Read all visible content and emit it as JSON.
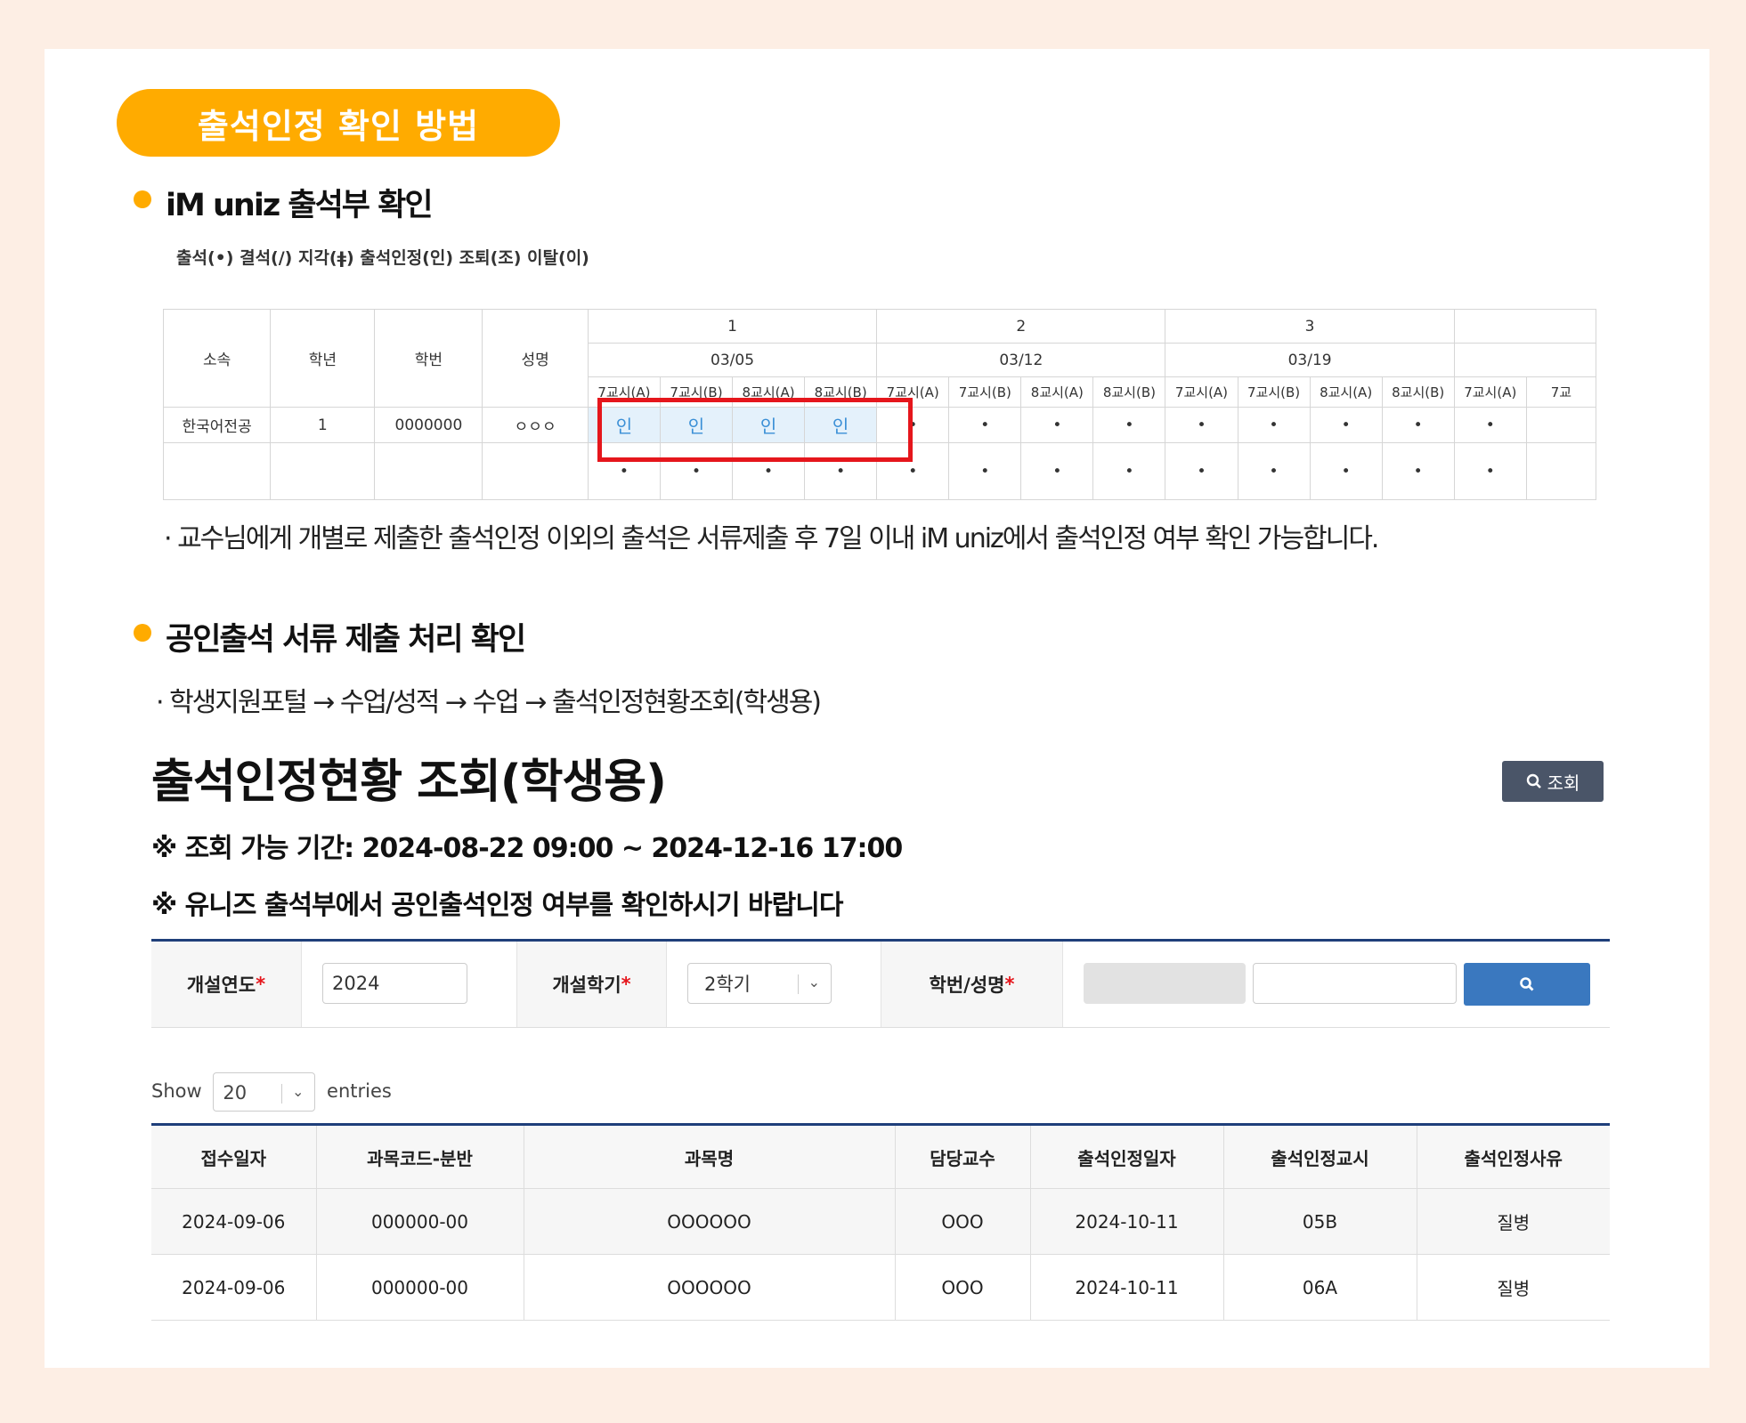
{
  "section_pill": "출석인정 확인 방법",
  "section1": {
    "heading": "iM uniz 출석부 확인",
    "legend": "출석(•) 결석(/) 지각(ǂ) 출석인정(인) 조퇴(조) 이탈(이)",
    "grid": {
      "headers": {
        "affiliation": "소속",
        "grade": "학년",
        "student_no": "학번",
        "name": "성명"
      },
      "weeks": [
        "1",
        "2",
        "3"
      ],
      "dates": [
        "03/05",
        "03/12",
        "03/19"
      ],
      "periods": [
        "7교시(A)",
        "7교시(B)",
        "8교시(A)",
        "8교시(B)",
        "7교시(A)",
        "7교시(B)",
        "8교시(A)",
        "8교시(B)",
        "7교시(A)",
        "7교시(B)",
        "8교시(A)",
        "8교시(B)",
        "7교시(A)",
        "7교"
      ],
      "row1": {
        "affiliation": "한국어전공",
        "grade": "1",
        "student_no": "0000000",
        "name": "ㅇㅇㅇ",
        "marks": [
          "인",
          "인",
          "인",
          "인",
          "•",
          "•",
          "•",
          "•",
          "•",
          "•",
          "•",
          "•",
          "•",
          ""
        ]
      },
      "row2": {
        "marks": [
          "•",
          "•",
          "•",
          "•",
          "•",
          "•",
          "•",
          "•",
          "•",
          "•",
          "•",
          "•",
          "•",
          ""
        ]
      }
    },
    "note": "· 교수님에게 개별로 제출한 출석인정 이외의 출석은 서류제출 후 7일 이내 iM uniz에서 출석인정 여부 확인 가능합니다."
  },
  "section2": {
    "heading": "공인출석 서류 제출 처리 확인",
    "path": "· 학생지원포털 → 수업/성적 → 수업 → 출석인정현황조회(학생용)"
  },
  "portal": {
    "title": "출석인정현황 조회(학생용)",
    "search_button": "조회",
    "period_note": "※ 조회 가능 기간: 2024-08-22 09:00 ~ 2024-12-16 17:00",
    "check_note": "※ 유니즈 출석부에서 공인출석인정 여부를 확인하시기 바랍니다",
    "filter": {
      "year_label": "개설연도",
      "year_value": "2024",
      "semester_label": "개설학기",
      "semester_value": "2학기",
      "student_label": "학번/성명",
      "required_mark": "*"
    },
    "show_label": "Show",
    "show_value": "20",
    "entries_label": "entries",
    "table": {
      "columns": [
        "접수일자",
        "과목코드-분반",
        "과목명",
        "담당교수",
        "출석인정일자",
        "출석인정교시",
        "출석인정사유"
      ],
      "rows": [
        [
          "2024-09-06",
          "000000-00",
          "OOOOOO",
          "OOO",
          "2024-10-11",
          "05B",
          "질병"
        ],
        [
          "2024-09-06",
          "000000-00",
          "OOOOOO",
          "OOO",
          "2024-10-11",
          "06A",
          "질병"
        ]
      ]
    }
  }
}
